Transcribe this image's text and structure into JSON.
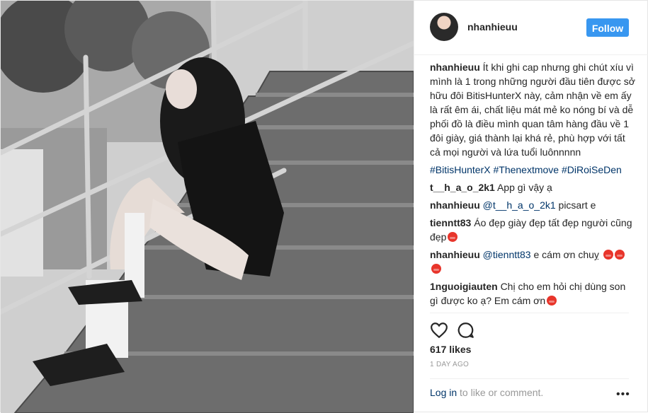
{
  "header": {
    "username": "nhanhieuu",
    "follow_label": "Follow"
  },
  "caption": {
    "username": "nhanhieuu",
    "text": "Ít khi ghi cap nhưng ghi chút xíu vì mình là 1 trong những người đầu tiên được sở hữu đôi BitisHunterX này, cảm nhận về em ấy là rất êm ái, chất liệu mát mẻ ko nóng bí và dễ phối đồ là điều mình quan tâm hàng đầu về 1 đôi giày, giá thành lại khá rẻ, phù hợp với tất cả mọi người và lứa tuổi luônnnnn",
    "hashtags": "#BitisHunterX #Thenextmove #DiRoiSeDen"
  },
  "comments": [
    {
      "user": "t__h_a_o_2k1",
      "text": "App gì vậy ạ"
    },
    {
      "user": "nhanhieuu",
      "mention": "@t__h_a_o_2k1",
      "text": " picsart e"
    },
    {
      "user": "tienntt83",
      "text": "Áo đẹp giày đẹp tất đẹp người cũng đẹp"
    },
    {
      "user": "nhanhieuu",
      "mention": "@tienntt83",
      "text": " e cám ơn chuỵ"
    },
    {
      "user": "1nguoigiauten",
      "text": "Chị cho em hỏi chị dùng son gì được ko ạ? Em cám ơn"
    }
  ],
  "stats": {
    "likes": "617 likes",
    "time": "1 DAY AGO"
  },
  "footer": {
    "login_label": "Log in",
    "rest": " to like or comment.",
    "more": "•••"
  },
  "icons": {
    "like": "heart-icon",
    "comment": "comment-bubble-icon",
    "more": "more-options-icon"
  },
  "colors": {
    "accent": "#3897f0",
    "link": "#003569",
    "meta": "#999999"
  }
}
